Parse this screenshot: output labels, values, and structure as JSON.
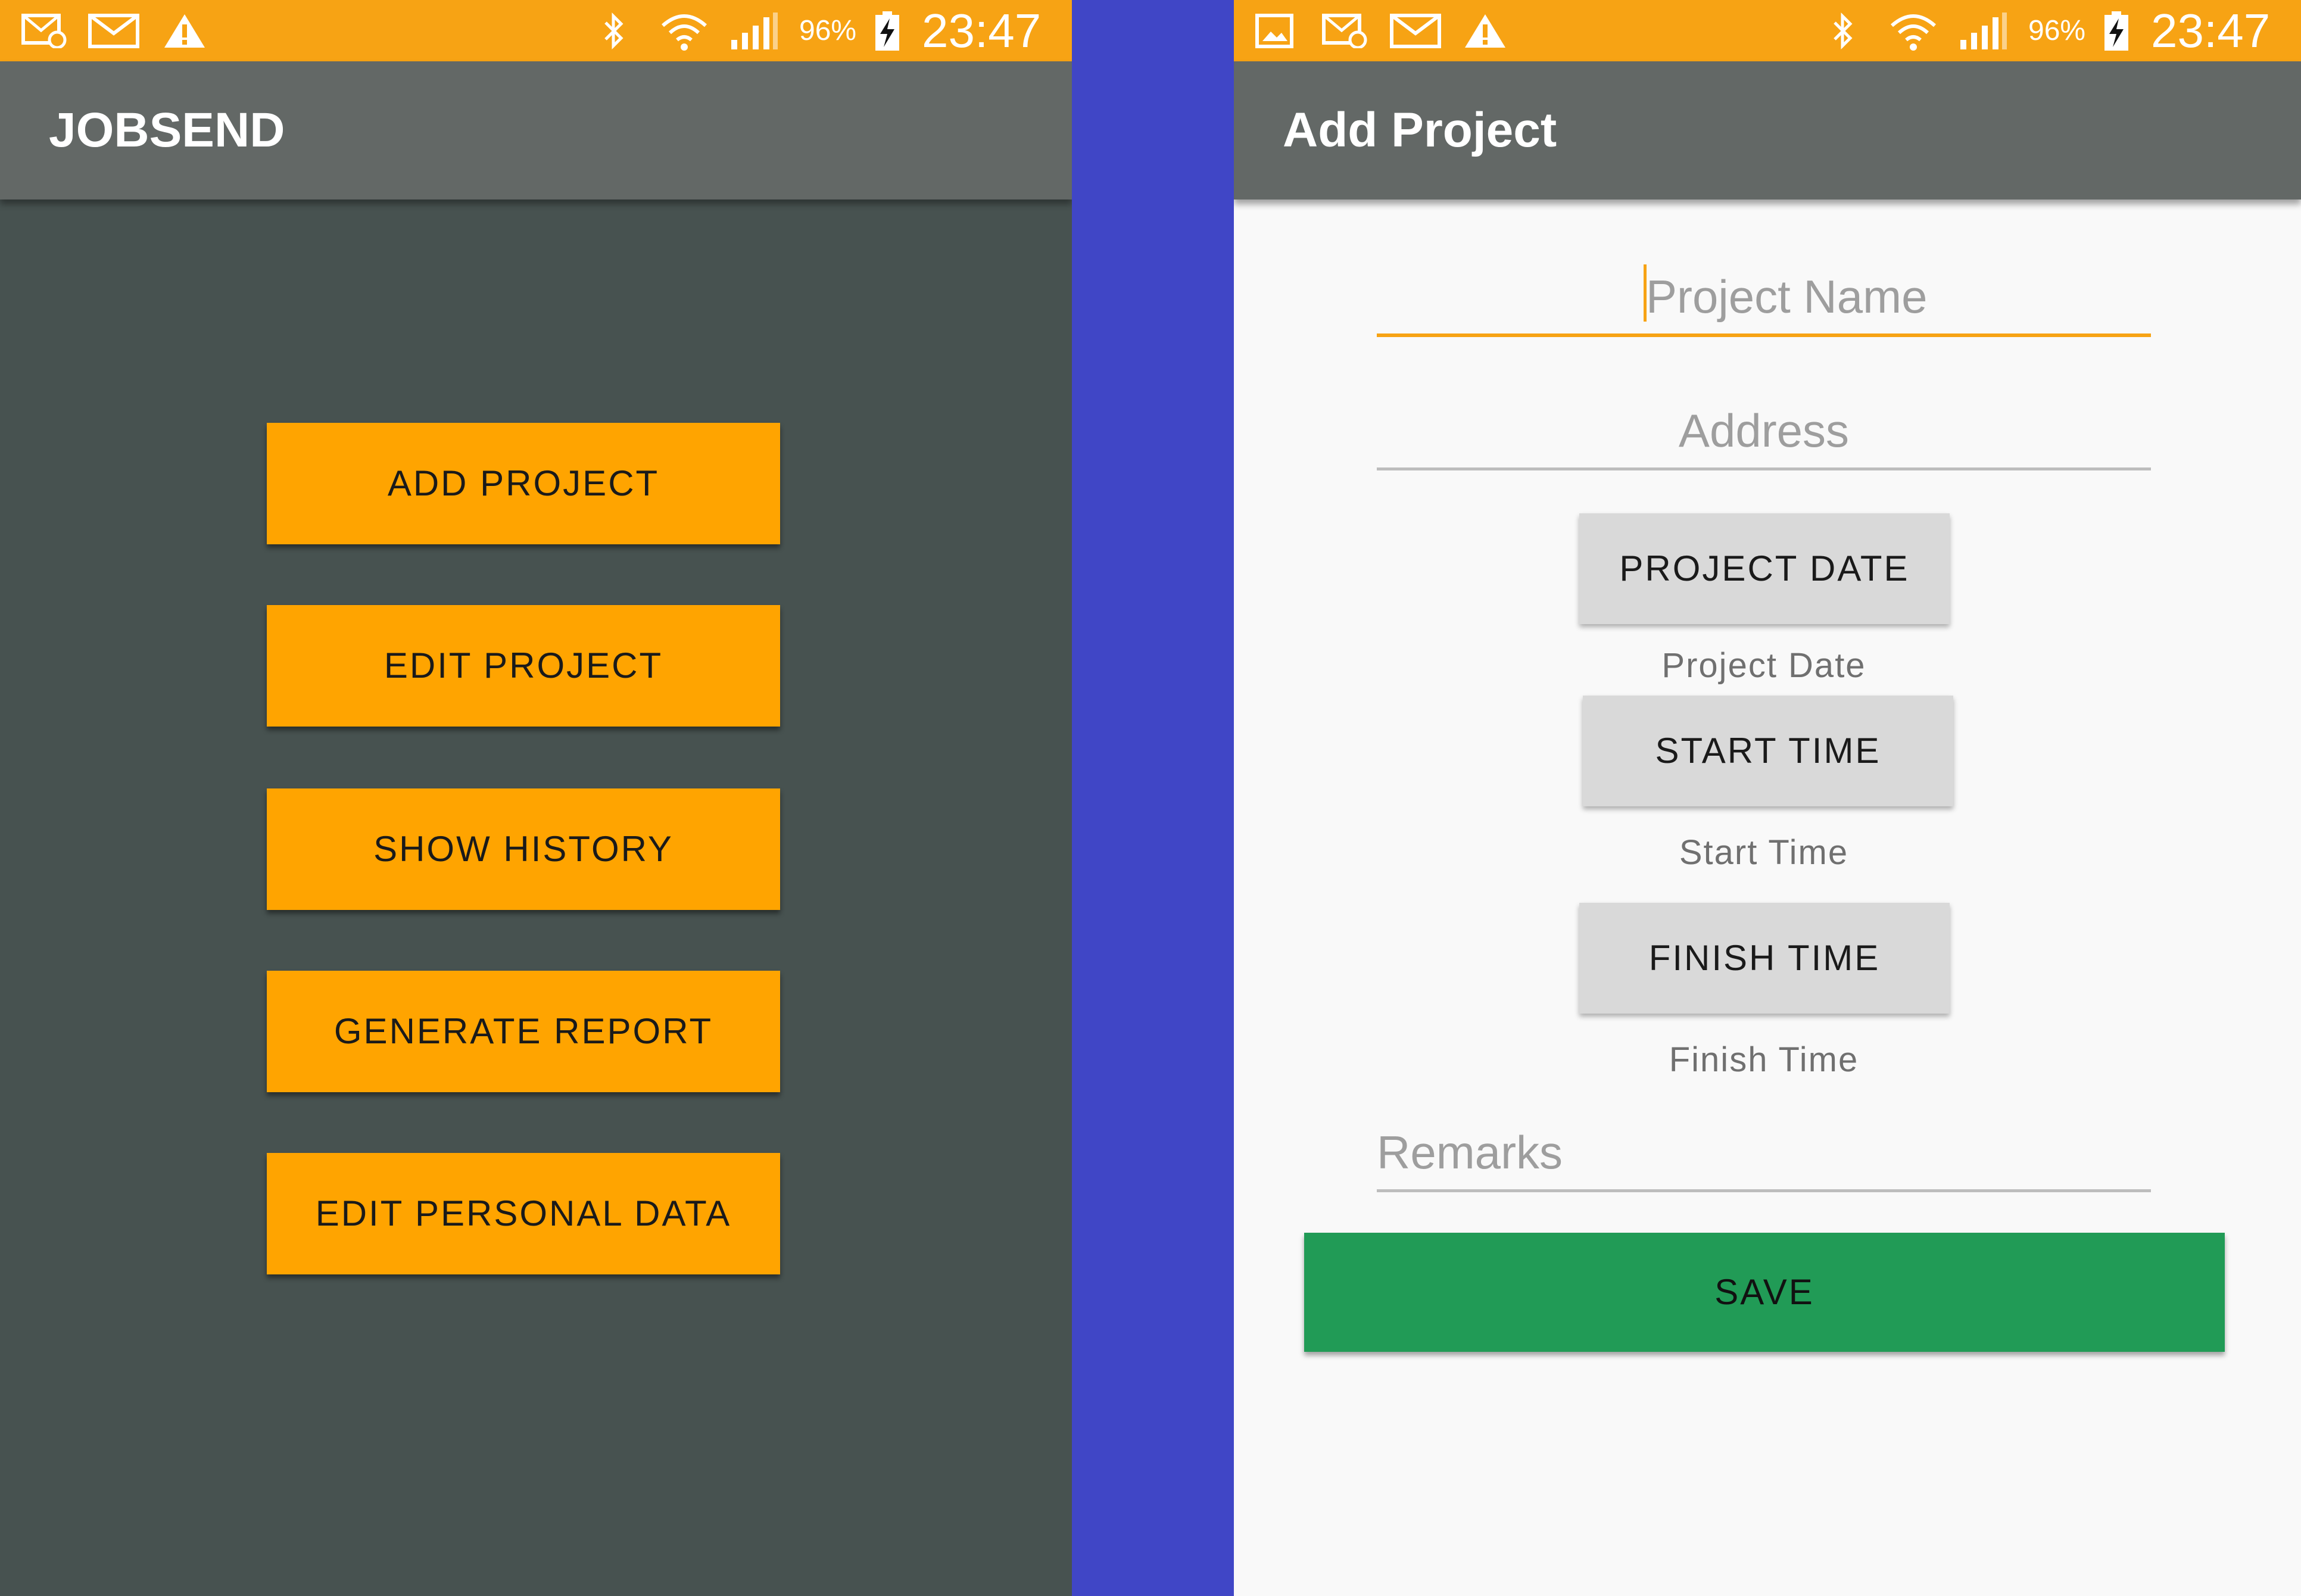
{
  "colors": {
    "status_bar": "#F7A314",
    "app_bar": "#636866",
    "left_background": "#475250",
    "right_background": "#F9F9F9",
    "divider_background": "#4046C6",
    "menu_button": "#FFA400",
    "grey_button": "#D9D9D9",
    "save_button": "#219B56",
    "focus_accent": "#F7A314"
  },
  "left_screen": {
    "status_bar": {
      "notification_icons": [
        "photo-mail-icon",
        "mail-icon",
        "warning-icon"
      ],
      "system_icons": [
        "bluetooth-icon",
        "wifi-icon",
        "signal-icon",
        "battery-charging-icon"
      ],
      "battery_text": "96%",
      "clock": "23:47"
    },
    "app_bar": {
      "title": "JOBSEND"
    },
    "menu": {
      "add_project": "ADD PROJECT",
      "edit_project": "EDIT PROJECT",
      "show_history": "SHOW HISTORY",
      "generate_report": "GENERATE REPORT",
      "edit_personal_data": "EDIT PERSONAL DATA"
    }
  },
  "right_screen": {
    "status_bar": {
      "notification_icons": [
        "gallery-icon",
        "photo-mail-icon",
        "mail-icon",
        "warning-icon"
      ],
      "system_icons": [
        "bluetooth-icon",
        "wifi-icon",
        "signal-icon",
        "battery-charging-icon"
      ],
      "battery_text": "96%",
      "clock": "23:47"
    },
    "app_bar": {
      "title": "Add Project"
    },
    "form": {
      "project_name_placeholder": "Project Name",
      "address_placeholder": "Address",
      "project_date_button": "PROJECT DATE",
      "project_date_value": "Project Date",
      "start_time_button": "START TIME",
      "start_time_value": "Start Time",
      "finish_time_button": "FINISH TIME",
      "finish_time_value": "Finish Time",
      "remarks_placeholder": "Remarks",
      "save_button": "SAVE"
    }
  }
}
